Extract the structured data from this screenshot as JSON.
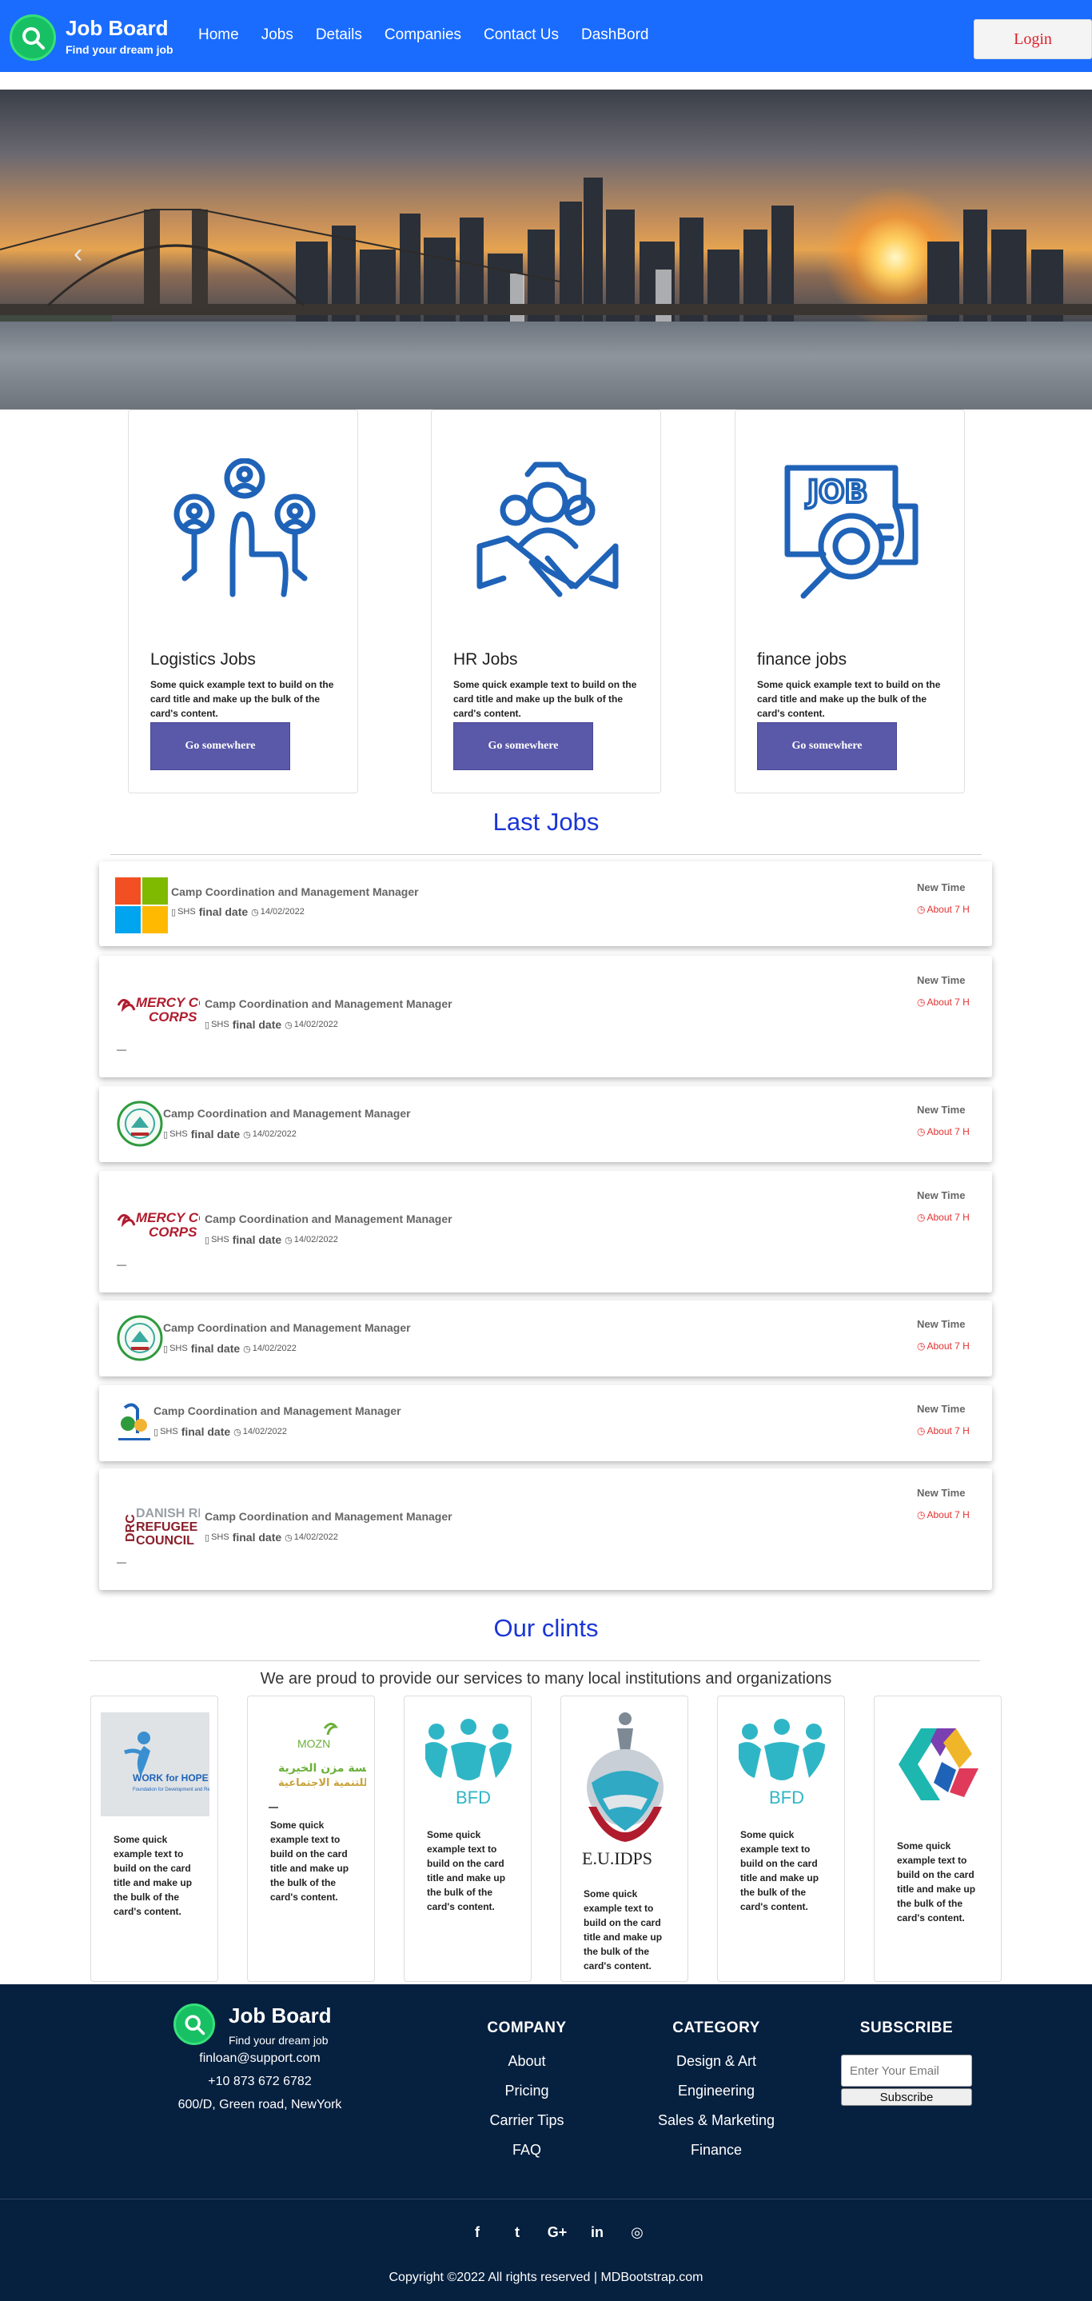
{
  "brand": {
    "title": "Job Board",
    "tagline": "Find your dream job"
  },
  "nav": {
    "items": [
      "Home",
      "Jobs",
      "Details",
      "Companies",
      "Contact Us",
      "DashBord"
    ],
    "login": "Login"
  },
  "categories": [
    {
      "title": "Logistics Jobs",
      "text": "Some quick example text to build on the card title and make up the bulk of the card's content.",
      "button": "Go somewhere",
      "icon": "network-hand-icon"
    },
    {
      "title": "HR Jobs",
      "text": "Some quick example text to build on the card title and make up the bulk of the card's content.",
      "button": "Go somewhere",
      "icon": "handshake-team-icon"
    },
    {
      "title": "finance jobs",
      "text": "Some quick example text to build on the card title and make up the bulk of the card's content.",
      "button": "Go somewhere",
      "icon": "job-search-icon"
    }
  ],
  "last_jobs": {
    "heading": "Last Jobs",
    "items": [
      {
        "title": "Camp Coordination and Management Manager",
        "location": "SHS",
        "final_label": "final date",
        "date": "14/02/2022",
        "new_label": "New Time",
        "ago": "About 7 H",
        "logo": "microsoft-logo"
      },
      {
        "title": "Camp Coordination and Management Manager",
        "location": "SHS",
        "final_label": "final date",
        "date": "14/02/2022",
        "new_label": "New Time",
        "ago": "About 7 H",
        "logo": "mercy-corps-logo",
        "logo_text": "MERCY CORPS"
      },
      {
        "title": "Camp Coordination and Management Manager",
        "location": "SHS",
        "final_label": "final date",
        "date": "14/02/2022",
        "new_label": "New Time",
        "ago": "About 7 H",
        "logo": "green-seal-logo"
      },
      {
        "title": "Camp Coordination and Management Manager",
        "location": "SHS",
        "final_label": "final date",
        "date": "14/02/2022",
        "new_label": "New Time",
        "ago": "About 7 H",
        "logo": "mercy-corps-logo",
        "logo_text": "MERCY CORPS"
      },
      {
        "title": "Camp Coordination and Management Manager",
        "location": "SHS",
        "final_label": "final date",
        "date": "14/02/2022",
        "new_label": "New Time",
        "ago": "About 7 H",
        "logo": "green-seal-logo"
      },
      {
        "title": "Camp Coordination and Management Manager",
        "location": "SHS",
        "final_label": "final date",
        "date": "14/02/2022",
        "new_label": "New Time",
        "ago": "About 7 H",
        "logo": "small-emblem-logo"
      },
      {
        "title": "Camp Coordination and Management Manager",
        "location": "SHS",
        "final_label": "final date",
        "date": "14/02/2022",
        "new_label": "New Time",
        "ago": "About 7 H",
        "logo": "danish-refugee-council-logo",
        "logo_text": "DANISH REFUGEE COUNCIL"
      }
    ]
  },
  "clients": {
    "heading": "Our clints",
    "subtitle": "We are proud to provide our services to many local institutions and organizations",
    "items": [
      {
        "logo": "work-for-hope-logo",
        "logo_text": "WORK for HOPE",
        "text": "Some quick example text to build on the card title and make up the bulk of the card's content."
      },
      {
        "logo": "mozn-logo",
        "logo_text": "MOZN",
        "text": "Some quick example text to build on the card title and make up the bulk of the card's content."
      },
      {
        "logo": "bfd-logo",
        "logo_text": "BFD",
        "text": "Some quick example text to build on the card title and make up the bulk of the card's content."
      },
      {
        "logo": "eu-idps-logo",
        "logo_text": "E.U.IDPS",
        "text": "Some quick example text to build on the card title and make up the bulk of the card's content."
      },
      {
        "logo": "bfd-logo",
        "logo_text": "BFD",
        "text": "Some quick example text to build on the card title and make up the bulk of the card's content."
      },
      {
        "logo": "geometric-logo",
        "text": "Some quick example text to build on the card title and make up the bulk of the card's content."
      }
    ]
  },
  "footer": {
    "email": "finloan@support.com",
    "phone": "+10 873 672 6782",
    "address": "600/D, Green road, NewYork",
    "company": {
      "heading": "COMPANY",
      "links": [
        "About",
        "Pricing",
        "Carrier Tips",
        "FAQ"
      ]
    },
    "category": {
      "heading": "CATEGORY",
      "links": [
        "Design & Art",
        "Engineering",
        "Sales & Marketing",
        "Finance"
      ]
    },
    "subscribe": {
      "heading": "SUBSCRIBE",
      "placeholder": "Enter Your Email",
      "button": "Subscribe"
    },
    "social": [
      "f",
      "t",
      "G+",
      "in",
      "◎"
    ],
    "copyright": "Copyright ©2022 All rights reserved | MDBootstrap.com"
  },
  "colors": {
    "nav": "#1a6cff",
    "accent_title": "#1a35d6",
    "button": "#5a58a8",
    "footer": "#06203f",
    "alert": "#e53030"
  }
}
